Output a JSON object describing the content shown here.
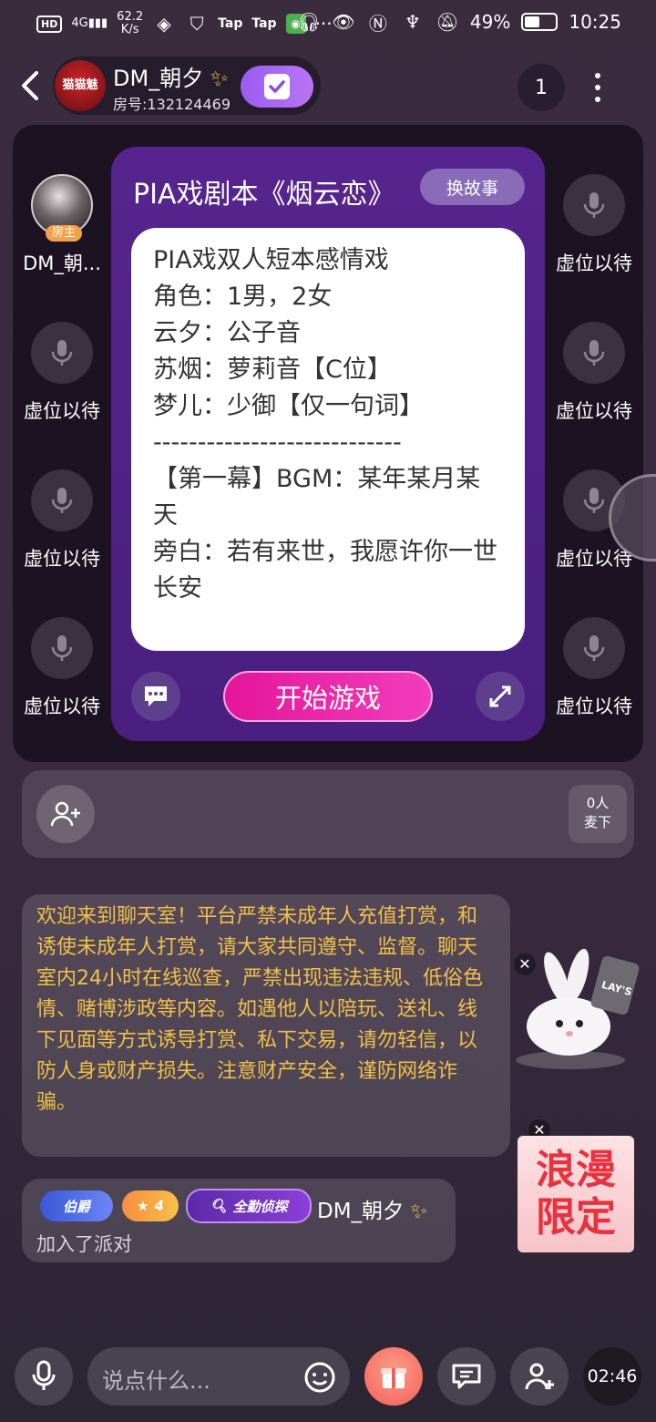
{
  "status_bar": {
    "net_speed_value": "62.2",
    "net_speed_unit": "K/s",
    "signal_label": "4G",
    "app_labels": [
      "Tap",
      "Tap"
    ],
    "battery": "49%",
    "time": "10:25"
  },
  "header": {
    "room_avatar_text": "猫猫魅",
    "room_name": "DM_朝夕",
    "room_id": "房号:132124469",
    "online_count": "1"
  },
  "seats": {
    "host_name": "DM_朝...",
    "host_badge": "房主",
    "empty_label": "虚位以待"
  },
  "script": {
    "title": "PIA戏剧本《烟云恋》",
    "swap_label": "换故事",
    "lines": [
      "PIA戏双人短本感情戏",
      "角色：1男，2女",
      "云夕：公子音",
      "苏烟：萝莉音【C位】",
      "梦儿：少御【仅一句词】",
      "----------------------------",
      "【第一幕】BGM：某年某月某天",
      "旁白：若有来世，我愿许你一世长安"
    ],
    "start_label": "开始游戏"
  },
  "queue": {
    "count_line1": "0人",
    "count_line2": "麦下"
  },
  "notice": {
    "text": "欢迎来到聊天室！平台严禁未成年人充值打赏，和诱使未成年人打赏，请大家共同遵守、监督。聊天室内24小时在线巡查，严禁出现违法违规、低俗色情、赌博涉政等内容。如遇他人以陪玩、送礼、线下见面等方式诱导打赏、私下交易，请勿轻信，以防人身或财产损失。注意财产安全，谨防网络诈骗。"
  },
  "join_message": {
    "badge_1": "伯爵",
    "badge_level": "4",
    "badge_2": "全勤侦探",
    "name": "DM_朝夕",
    "text": "加入了派对"
  },
  "ads": {
    "bunny_brand": "LAY'S",
    "romance_line1": "浪漫",
    "romance_line2": "限定"
  },
  "bottom_bar": {
    "input_placeholder": "说点什么...",
    "timer": "02:46"
  },
  "colors": {
    "panel_purple": "#56248e",
    "start_button": "#e4169a",
    "notice_text": "#f0c048",
    "accent_violet": "#9b5cf0"
  }
}
